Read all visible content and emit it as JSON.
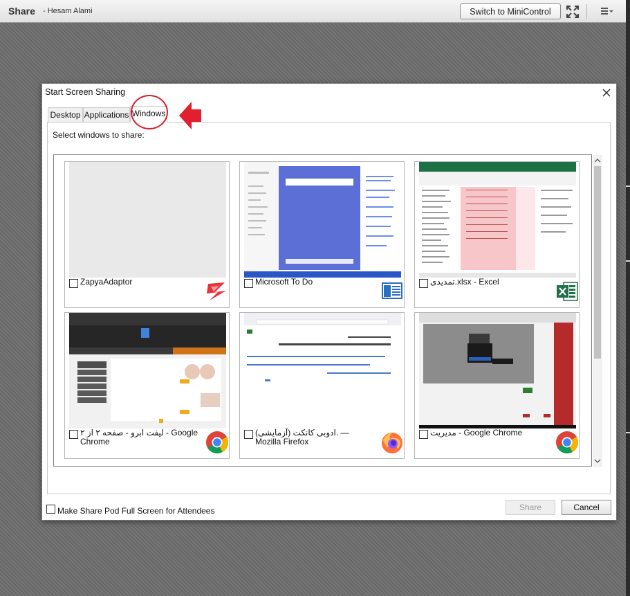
{
  "pod": {
    "title": "Share",
    "user": "- Hesam Alami",
    "mini_control_label": "Switch to MiniControl",
    "fullscreen_icon": "fullscreen-icon",
    "menu_icon": "menu-icon"
  },
  "dialog": {
    "title": "Start Screen Sharing",
    "close_icon": "close-icon",
    "tabs": [
      {
        "label": "Desktop",
        "active": false
      },
      {
        "label": "Applications",
        "active": false
      },
      {
        "label": "Windows",
        "active": true
      }
    ],
    "select_label": "Select windows to share:",
    "windows": [
      {
        "label": "ZapyaAdaptor",
        "icon": "zapya-icon",
        "checked": false
      },
      {
        "label": "Microsoft To Do",
        "icon": "todo-icon",
        "checked": false
      },
      {
        "label": "تمدیدی.xlsx - Excel",
        "icon": "excel-icon",
        "checked": false
      },
      {
        "label": "لیفت ابرو - صفحه ۲ از ۲ - Google Chrome",
        "icon": "chrome-icon",
        "checked": false
      },
      {
        "label": "ادوبی کانکت (آزمایشی). — Mozilla Firefox",
        "icon": "firefox-icon",
        "checked": false
      },
      {
        "label": "مدیریت - Google Chrome",
        "icon": "chrome-icon",
        "checked": false
      }
    ],
    "fullscreen_checkbox_label": "Make Share Pod Full Screen for Attendees",
    "share_button": "Share",
    "cancel_button": "Cancel"
  },
  "colors": {
    "annotation_red": "#d4202c",
    "todo_blue": "#5b6fd6",
    "excel_green": "#1e7145",
    "dialog_bg": "#ffffff"
  }
}
